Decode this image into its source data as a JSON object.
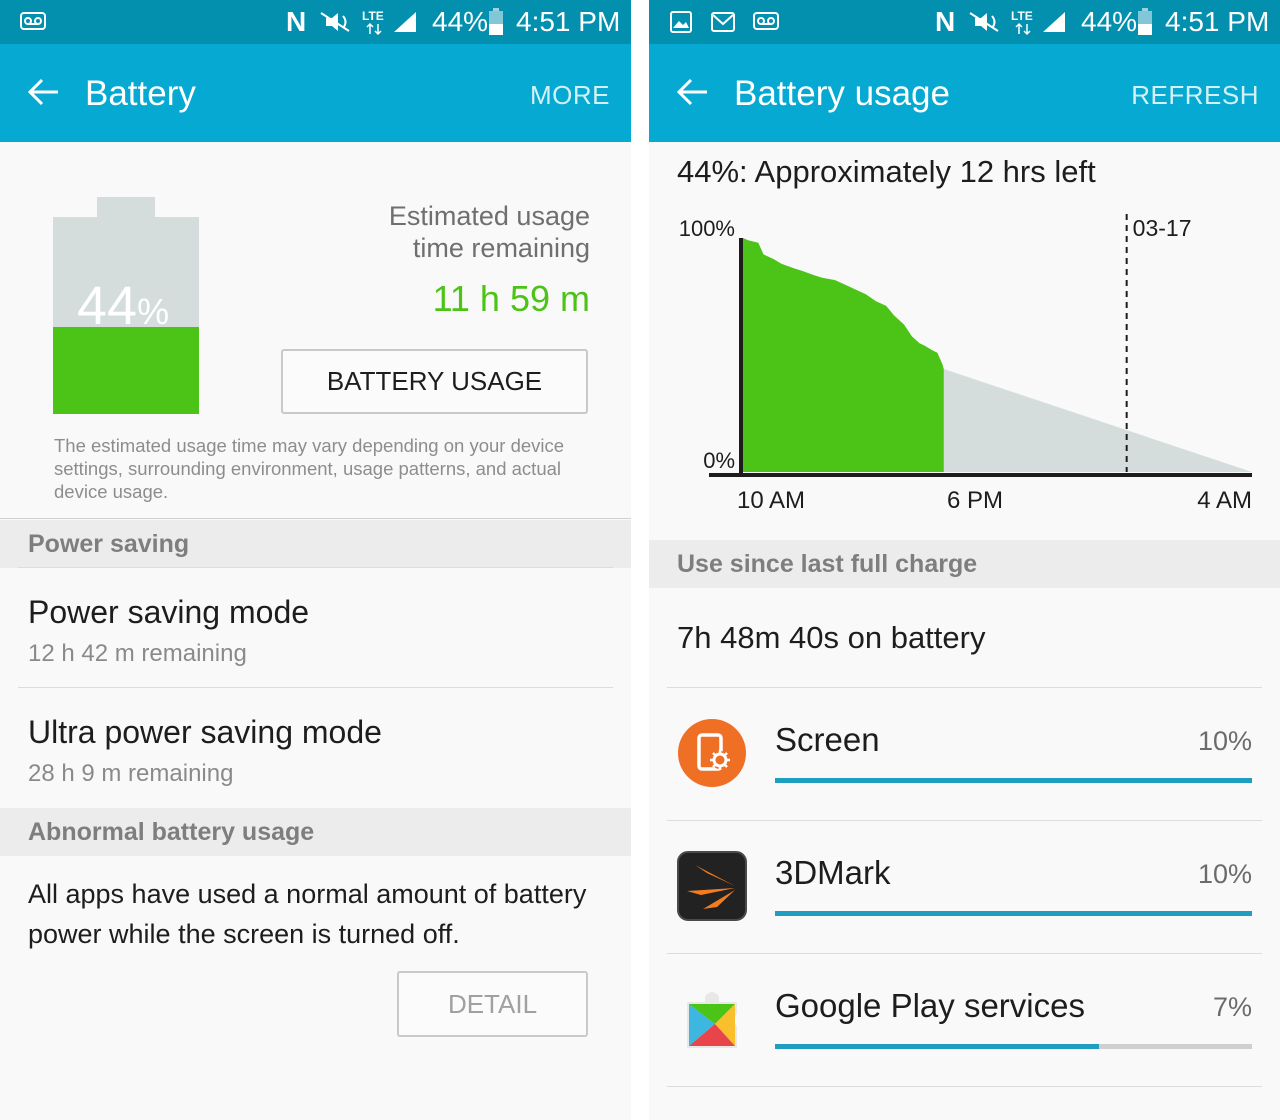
{
  "colors": {
    "status_bar": "#038fae",
    "app_bar": "#06a9d1",
    "battery_green": "#4cc417",
    "estimate_gray": "#d4dcdc",
    "usage_bar_blue": "#1f9ec2",
    "screen_icon_orange": "#ef7025"
  },
  "left": {
    "status": {
      "icons": [
        "voicemail-icon",
        "nfc-icon",
        "mute-icon",
        "lte-icon",
        "signal-icon",
        "battery-status-icon"
      ],
      "battery": "44%",
      "time": "4:51 PM"
    },
    "appbar": {
      "title": "Battery",
      "action": "MORE"
    },
    "battery": {
      "level_percent": 44,
      "level_number": "44",
      "level_unit": "%",
      "estimate_line1": "Estimated usage",
      "estimate_line2": "time remaining",
      "estimate_value": "11 h 59 m",
      "usage_button": "BATTERY USAGE",
      "disclaimer": "The estimated usage time may vary depending on your device settings, surrounding environment, usage patterns, and actual device usage."
    },
    "power_saving": {
      "header": "Power saving",
      "mode_title": "Power saving mode",
      "mode_sub": "12 h 42 m remaining",
      "ultra_title": "Ultra power saving mode",
      "ultra_sub": "28 h 9 m remaining"
    },
    "abnormal": {
      "header": "Abnormal battery usage",
      "message": "All apps have used a normal amount of battery power while the screen is turned off.",
      "detail_button": "DETAIL"
    }
  },
  "right": {
    "status": {
      "icons": [
        "image-icon",
        "gmail-icon",
        "voicemail-icon",
        "nfc-icon",
        "mute-icon",
        "lte-icon",
        "signal-icon",
        "battery-status-icon"
      ],
      "battery": "44%",
      "time": "4:51 PM"
    },
    "appbar": {
      "title": "Battery usage",
      "action": "REFRESH"
    },
    "summary": "44%: Approximately 12 hrs left",
    "since_header": "Use since last full charge",
    "on_battery": "7h 48m 40s on battery",
    "apps": [
      {
        "name": "Screen",
        "percent_label": "10%",
        "bar_fraction": 1.0,
        "icon": "screen-settings-icon"
      },
      {
        "name": "3DMark",
        "percent_label": "10%",
        "bar_fraction": 1.0,
        "icon": "3dmark-icon"
      },
      {
        "name": "Google Play services",
        "percent_label": "7%",
        "bar_fraction": 0.68,
        "icon": "google-play-services-icon"
      }
    ]
  },
  "chart_data": {
    "type": "area",
    "ytick_labels": [
      "100%",
      "0%"
    ],
    "xtick_labels": [
      "10 AM",
      "6 PM",
      "4 AM"
    ],
    "marker_label": "03-17",
    "ylim": [
      0,
      100
    ],
    "series": [
      {
        "kind": "actual",
        "hours_from_start": [
          0,
          0.2,
          0.6,
          0.8,
          1.2,
          1.5,
          2.0,
          2.3,
          2.8,
          3.1,
          3.6,
          4.0,
          4.4,
          4.8,
          5.2,
          5.6,
          5.9,
          6.3,
          6.6,
          6.9,
          7.1,
          7.4,
          7.6,
          7.8,
          7.85
        ],
        "battery_percent": [
          100,
          99,
          98,
          93,
          91,
          89,
          87,
          86,
          84,
          83,
          82,
          80,
          78,
          76,
          73,
          71,
          67,
          63,
          58,
          55,
          54,
          52,
          51,
          46,
          44
        ]
      },
      {
        "kind": "estimate",
        "hours_from_start": [
          7.85,
          19.9
        ],
        "battery_percent": [
          44,
          0
        ]
      }
    ],
    "marker_hours_from_start": 15
  }
}
